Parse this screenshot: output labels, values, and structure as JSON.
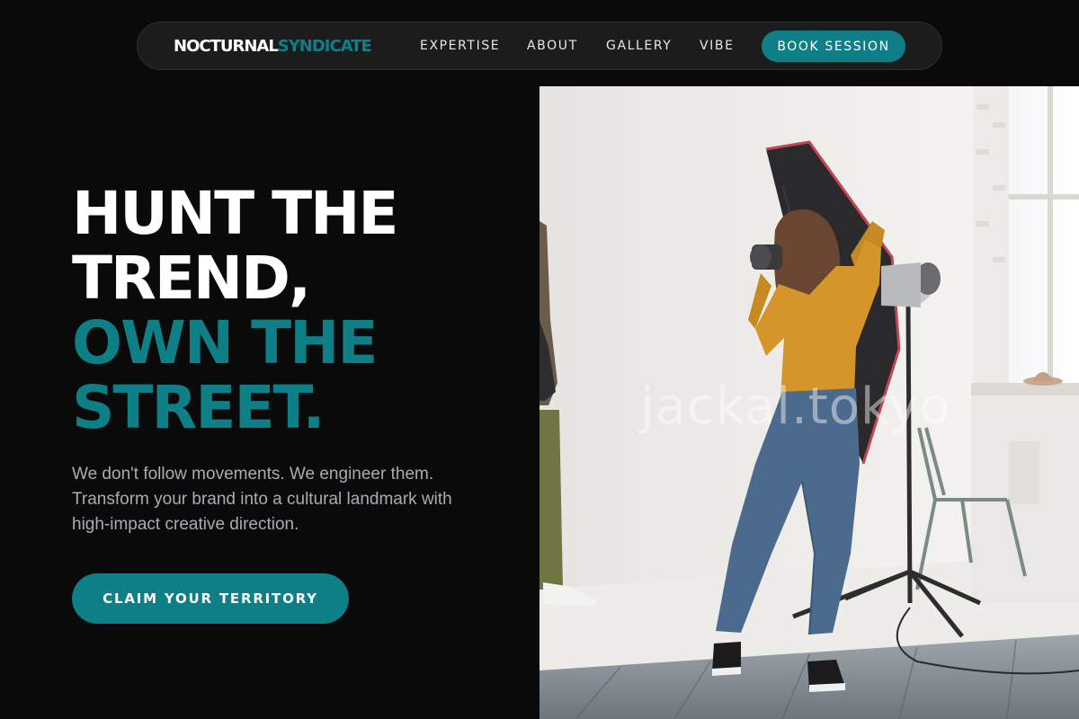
{
  "nav": {
    "logo_primary": "NOCTURNAL",
    "logo_secondary": "SYNDICATE",
    "links": [
      {
        "label": "EXPERTISE"
      },
      {
        "label": "ABOUT"
      },
      {
        "label": "GALLERY"
      },
      {
        "label": "VIBE"
      }
    ],
    "cta_label": "BOOK SESSION"
  },
  "hero": {
    "headline_lines": [
      "HUNT THE",
      "TREND,",
      "OWN THE",
      "STREET."
    ],
    "subtitle": "We don't follow movements. We engineer them. Transform your brand into a cultural landmark with high-impact creative direction.",
    "cta_label": "CLAIM YOUR TERRITORY"
  },
  "image": {
    "watermark": "jackal.tokyo",
    "subject": "photographer-in-white-studio"
  },
  "colors": {
    "background": "#0a0a0a",
    "accent": "#0e7f86",
    "nav_background": "#1c1c1c",
    "body_text": "#a8adb5"
  }
}
